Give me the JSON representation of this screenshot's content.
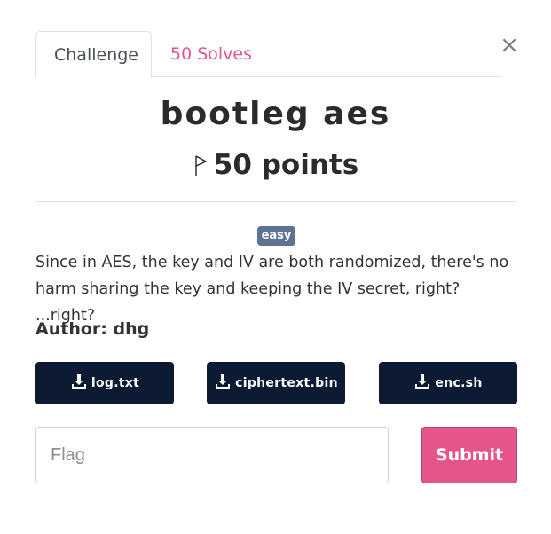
{
  "modal": {
    "close_label": "×",
    "tabs": [
      {
        "label": "Challenge",
        "active": true
      },
      {
        "label": "50 Solves",
        "active": false
      }
    ],
    "challenge": {
      "name": "bootleg aes",
      "points": "50 points",
      "difficulty_badge": "easy",
      "description": "Since in AES, the key and IV are both randomized, there's no harm sharing the key and keeping the IV secret, right? ...right?",
      "author": "Author: dhg"
    },
    "files": [
      {
        "label": "log.txt",
        "icon": "download-icon"
      },
      {
        "label": "ciphertext.bin",
        "icon": "download-icon"
      },
      {
        "label": "enc.sh",
        "icon": "download-icon"
      }
    ],
    "flag_input": {
      "placeholder": "Flag",
      "value": ""
    },
    "submit_label": "Submit",
    "colors": {
      "accent": "#e5548a",
      "file_button": "#0c1a33",
      "badge": "#5d7394"
    }
  }
}
